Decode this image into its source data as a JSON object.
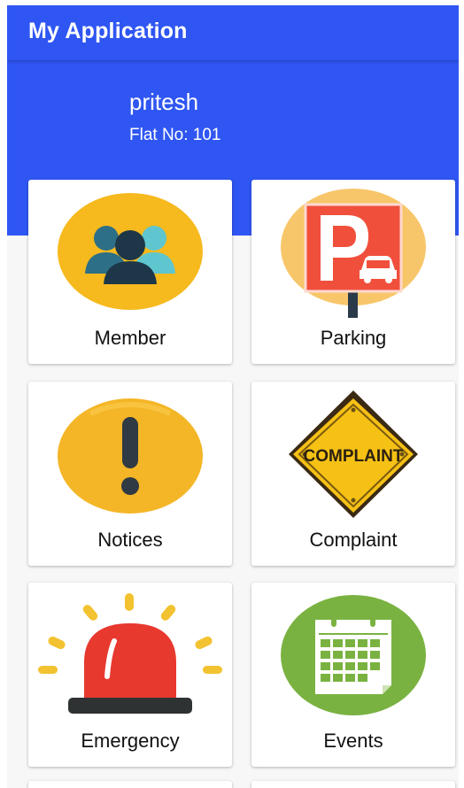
{
  "app": {
    "title": "My Application",
    "brand_color": "#2f56f2"
  },
  "profile": {
    "name": "pritesh",
    "flat": "Flat No: 101"
  },
  "menu": {
    "items": [
      {
        "label": "Member",
        "icon": "members-group-icon"
      },
      {
        "label": "Parking",
        "icon": "parking-sign-icon"
      },
      {
        "label": "Notices",
        "icon": "exclamation-icon"
      },
      {
        "label": "Complaint",
        "icon": "complaint-sign-icon",
        "sign_text": "COMPLAINT"
      },
      {
        "label": "Emergency",
        "icon": "siren-icon"
      },
      {
        "label": "Events",
        "icon": "calendar-icon"
      }
    ]
  }
}
